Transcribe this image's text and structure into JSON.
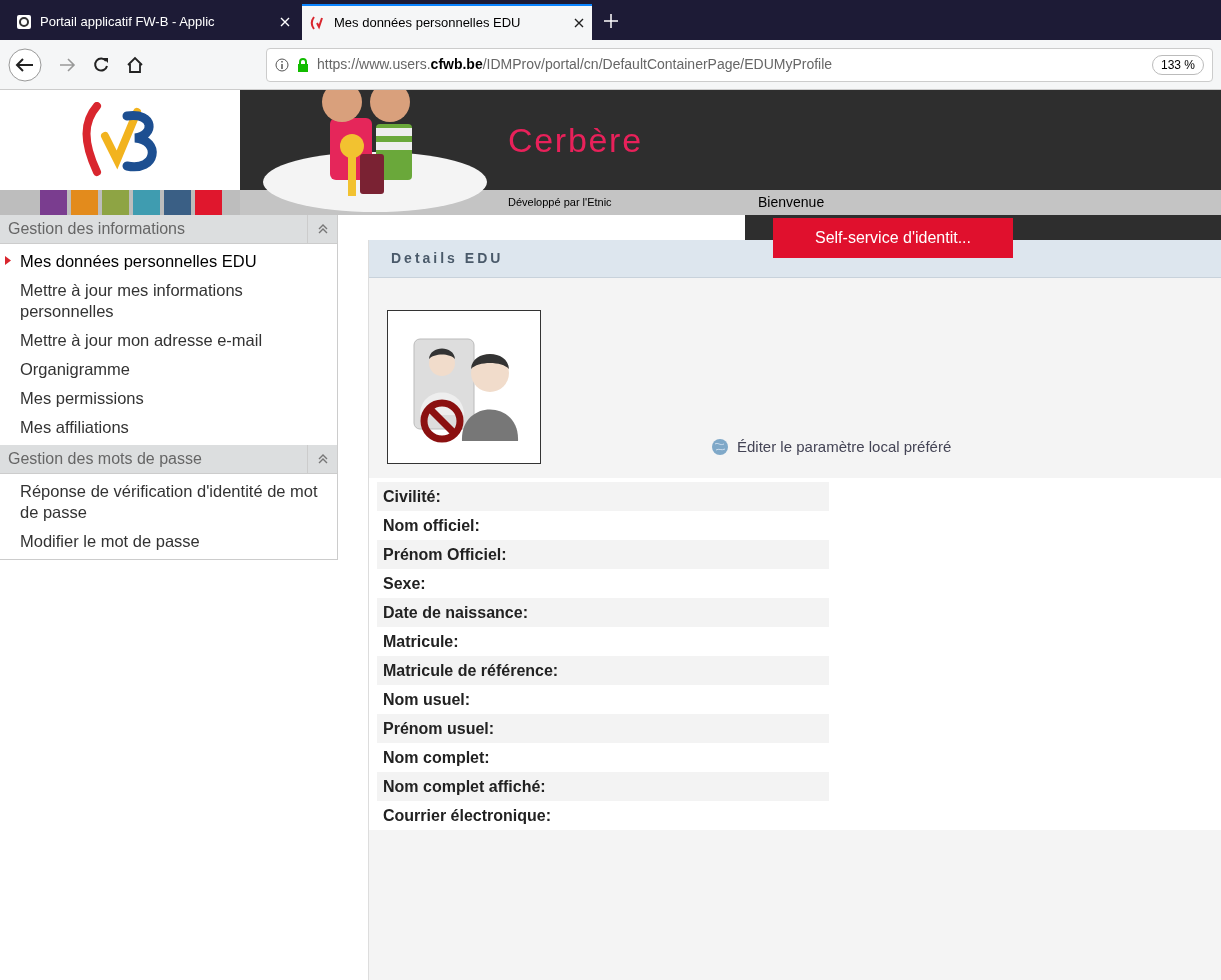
{
  "browser_tabs": [
    {
      "title": "Portail applicatif FW-B - Applic",
      "selected": false
    },
    {
      "title": "Mes données personnelles EDU",
      "selected": true
    }
  ],
  "address_bar": {
    "url_prefix": "https://www.users.",
    "url_domain": "cfwb.be",
    "url_path": "/IDMProv/portal/cn/DefaultContainerPage/EDUMyProfile",
    "zoom": "133 %"
  },
  "header": {
    "app_name": "Cerbère",
    "developer": "Développé par l'Etnic",
    "welcome": "Bienvenue",
    "self_service_button": "Self-service d'identit..."
  },
  "sidebar": {
    "sections": [
      {
        "title": "Gestion des informations",
        "expanded": true,
        "items": [
          {
            "label": "Mes données personnelles EDU",
            "selected": true
          },
          {
            "label": "Mettre à jour mes informations personnelles",
            "selected": false
          },
          {
            "label": "Mettre à jour mon adresse e-mail",
            "selected": false
          },
          {
            "label": "Organigramme",
            "selected": false
          },
          {
            "label": "Mes permissions",
            "selected": false
          },
          {
            "label": "Mes affiliations",
            "selected": false
          }
        ]
      },
      {
        "title": "Gestion des mots de passe",
        "expanded": true,
        "items": [
          {
            "label": "Réponse de vérification d'identité de mot de passe",
            "selected": false
          },
          {
            "label": "Modifier le mot de passe",
            "selected": false
          }
        ]
      }
    ]
  },
  "panel": {
    "title": "Details EDU",
    "locale_link": "Éditer le paramètre local préféré",
    "fields": [
      "Civilité:",
      "Nom officiel:",
      "Prénom Officiel:",
      "Sexe:",
      "Date de naissance:",
      "Matricule:",
      "Matricule de référence:",
      "Nom usuel:",
      "Prénom usuel:",
      "Nom complet:",
      "Nom complet affiché:",
      "Courrier électronique:"
    ]
  }
}
